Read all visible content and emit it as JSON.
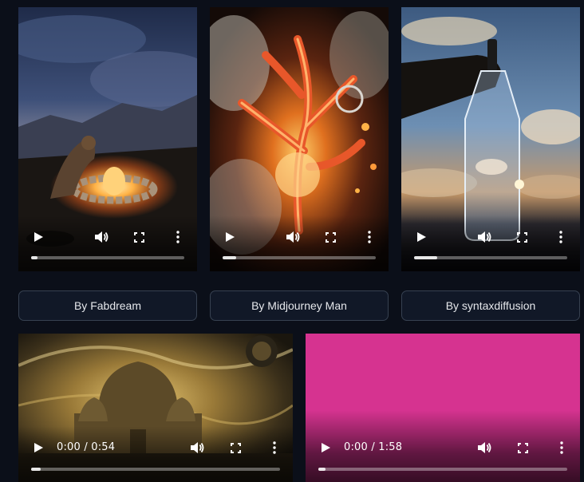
{
  "gallery": {
    "row1": [
      {
        "caption": "By Fabdream",
        "progress": 0.04
      },
      {
        "caption": "By Midjourney Man",
        "progress": 0.09
      },
      {
        "caption": "By syntaxdiffusion",
        "progress": 0.15
      }
    ],
    "row2": [
      {
        "time": "0:00 / 0:54",
        "progress": 0.04
      },
      {
        "time": "0:00 / 1:58",
        "progress": 0.03
      }
    ]
  },
  "colors": {
    "background": "#0b0f19",
    "button_bg": "#111827",
    "button_border": "#374151",
    "magenta": "#d63390"
  },
  "icons": {
    "play": "play-icon",
    "volume": "volume-icon",
    "fullscreen": "fullscreen-icon",
    "more": "more-vertical-icon"
  }
}
